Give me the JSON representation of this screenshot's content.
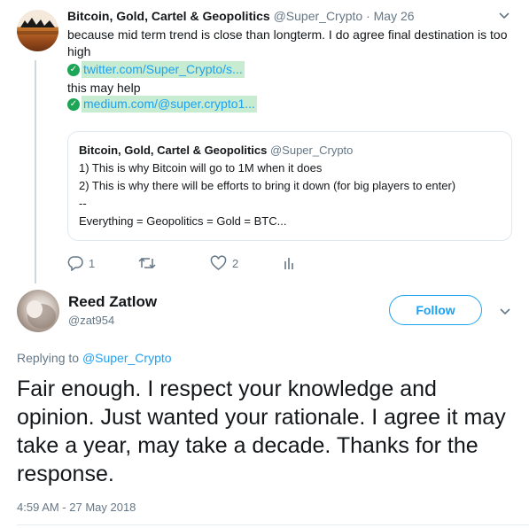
{
  "parent_tweet": {
    "name": "Bitcoin, Gold, Cartel & Geopolitics",
    "handle": "@Super_Crypto",
    "separator": "·",
    "date": "May 26",
    "text": "because mid term trend is close than longterm. I do agree final destination is too high",
    "link1": "twitter.com/Super_Crypto/s...",
    "line2": "this may help",
    "link2": "medium.com/@super.crypto1...",
    "quote": {
      "name": "Bitcoin, Gold, Cartel & Geopolitics",
      "handle": "@Super_Crypto",
      "lines": [
        "1) This is why Bitcoin will go to 1M when it does",
        "2) This is why there will be efforts to bring it down (for big players to enter)",
        "--",
        "Everything = Geopolitics = Gold = BTC..."
      ]
    },
    "actions": {
      "reply_count": "1",
      "like_count": "2"
    }
  },
  "main_tweet": {
    "name": "Reed Zatlow",
    "handle": "@zat954",
    "follow_label": "Follow",
    "replying_prefix": "Replying to",
    "replying_to": "@Super_Crypto",
    "text": "Fair enough. I respect your knowledge and opinion. Just wanted your rationale. I agree it may take a year, may take a decade. Thanks for the response.",
    "timestamp": "4:59 AM - 27 May 2018"
  },
  "colors": {
    "accent": "#1da1f2",
    "muted": "#657786",
    "text": "#14171a",
    "link_highlight": "#c7ecd2",
    "check_green": "#1da556"
  },
  "icons": [
    "reply-icon",
    "retweet-icon",
    "like-icon",
    "analytics-icon",
    "chevron-down-icon",
    "check-circle-icon"
  ]
}
